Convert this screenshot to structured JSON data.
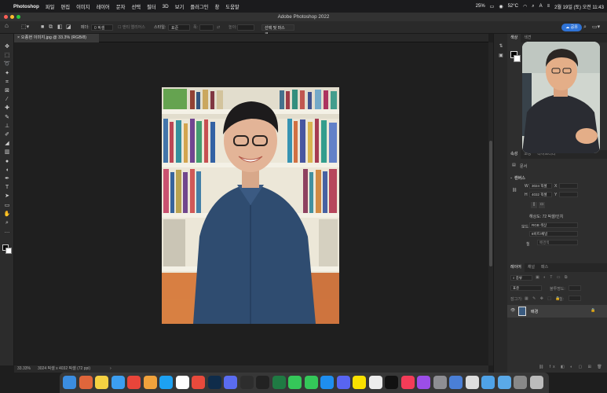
{
  "menubar": {
    "apple": "",
    "app_name": "Photoshop",
    "items": [
      "파일",
      "편집",
      "이미지",
      "레이어",
      "문자",
      "선택",
      "필터",
      "3D",
      "보기",
      "플러그인",
      "창",
      "도움말"
    ],
    "battery": "25%",
    "temp": "52°C",
    "datetime": "2월 19일 (토) 오전 11:43"
  },
  "window": {
    "title": "Adobe Photoshop 2022"
  },
  "options_bar": {
    "feather_label": "페더:",
    "feather_value": "0 픽셀",
    "antialias_label": "앤티 앨리어스",
    "style_label": "스타일:",
    "style_value": "표준",
    "width_label": "폭:",
    "height_label": "높이:",
    "select_mask_button": "선택 및 마스크...",
    "share_button": "공유"
  },
  "document": {
    "tab_label": "오종현 이미지.jpg @ 33.3% (RGB/8)",
    "zoom": "33.33%",
    "dimensions": "3024 픽셀 x 4032 픽셀 (72 ppi)"
  },
  "panels": {
    "top_tabs": [
      "색상",
      "색견"
    ],
    "properties_tabs": [
      "속성",
      "조정",
      "라이브러리"
    ],
    "doc_label": "문서",
    "canvas_section": "캔버스",
    "w_label": "W",
    "w_value": "3024 픽셀",
    "h_label": "H",
    "h_value": "4032 픽셀",
    "x_label": "X",
    "y_label": "Y",
    "resolution": "해상도: 72 픽셀/인치",
    "mode_label": "모드",
    "mode_value": "RGB 색상",
    "bit_value": "8비트/채널",
    "fill_label": "칠",
    "fill_value": "배경색",
    "layers_tabs": [
      "레이어",
      "채널",
      "패스"
    ],
    "layer_kind": "종류",
    "blend_mode": "표준",
    "opacity_label": "불투명도:",
    "lock_label": "잠그기:",
    "fill2_label": "칠:",
    "layer_name": "배경"
  },
  "tools": [
    {
      "icon": "move-icon",
      "glyph": "✥"
    },
    {
      "icon": "marquee-icon",
      "glyph": "⬚"
    },
    {
      "icon": "lasso-icon",
      "glyph": "➰"
    },
    {
      "icon": "magic-wand-icon",
      "glyph": "✦"
    },
    {
      "icon": "crop-icon",
      "glyph": "⌗"
    },
    {
      "icon": "frame-icon",
      "glyph": "⊠"
    },
    {
      "icon": "eyedropper-icon",
      "glyph": "⁄"
    },
    {
      "icon": "healing-icon",
      "glyph": "✚"
    },
    {
      "icon": "brush-icon",
      "glyph": "✎"
    },
    {
      "icon": "stamp-icon",
      "glyph": "⊥"
    },
    {
      "icon": "history-brush-icon",
      "glyph": "✐"
    },
    {
      "icon": "eraser-icon",
      "glyph": "◢"
    },
    {
      "icon": "gradient-icon",
      "glyph": "▥"
    },
    {
      "icon": "blur-icon",
      "glyph": "●"
    },
    {
      "icon": "dodge-icon",
      "glyph": "◖"
    },
    {
      "icon": "pen-icon",
      "glyph": "✒"
    },
    {
      "icon": "type-icon",
      "glyph": "T"
    },
    {
      "icon": "path-select-icon",
      "glyph": "➤"
    },
    {
      "icon": "rectangle-icon",
      "glyph": "▭"
    },
    {
      "icon": "hand-icon",
      "glyph": "✋"
    },
    {
      "icon": "zoom-icon",
      "glyph": "⌕"
    },
    {
      "icon": "more-icon",
      "glyph": "…"
    }
  ],
  "dock_apps": [
    {
      "icon": "finder-icon",
      "color": "#3b8de0"
    },
    {
      "icon": "launchpad-icon",
      "color": "#e0663b"
    },
    {
      "icon": "notes-icon",
      "color": "#f5d142"
    },
    {
      "icon": "safari-icon",
      "color": "#3c9ef0"
    },
    {
      "icon": "chrome-icon",
      "color": "#e9453a"
    },
    {
      "icon": "photos-icon",
      "color": "#f0a23c"
    },
    {
      "icon": "twitter-icon",
      "color": "#1da1f2"
    },
    {
      "icon": "calendar-icon",
      "color": "#ffffff"
    },
    {
      "icon": "todo-icon",
      "color": "#e84a3c"
    },
    {
      "icon": "photoshop-icon",
      "color": "#0f2c4a"
    },
    {
      "icon": "vpn-icon",
      "color": "#5a6cf0"
    },
    {
      "icon": "clipstudio-icon",
      "color": "#2d2d2d"
    },
    {
      "icon": "obs-icon",
      "color": "#222222"
    },
    {
      "icon": "excel-icon",
      "color": "#1f7a43"
    },
    {
      "icon": "facetime-icon",
      "color": "#35c759"
    },
    {
      "icon": "messages-icon",
      "color": "#34c759"
    },
    {
      "icon": "appstore-icon",
      "color": "#1e8ef0"
    },
    {
      "icon": "discord-icon",
      "color": "#5865f2"
    },
    {
      "icon": "kakao-icon",
      "color": "#fae100"
    },
    {
      "icon": "avatar-app-icon",
      "color": "#ececec"
    },
    {
      "icon": "appletv-icon",
      "color": "#111111"
    },
    {
      "icon": "music-icon",
      "color": "#f33c58"
    },
    {
      "icon": "podcasts-icon",
      "color": "#9b4ee8"
    },
    {
      "icon": "settings-icon",
      "color": "#8e8e93"
    },
    {
      "icon": "preview-icon",
      "color": "#4a7fd6"
    },
    {
      "icon": "chess-icon",
      "color": "#dddddd"
    },
    {
      "icon": "folder-icon",
      "color": "#4fa3e8"
    },
    {
      "icon": "downloads-icon",
      "color": "#5aa9e8"
    },
    {
      "icon": "screenshot-icon",
      "color": "#888888"
    },
    {
      "icon": "trash-icon",
      "color": "#bbbbbb"
    }
  ]
}
